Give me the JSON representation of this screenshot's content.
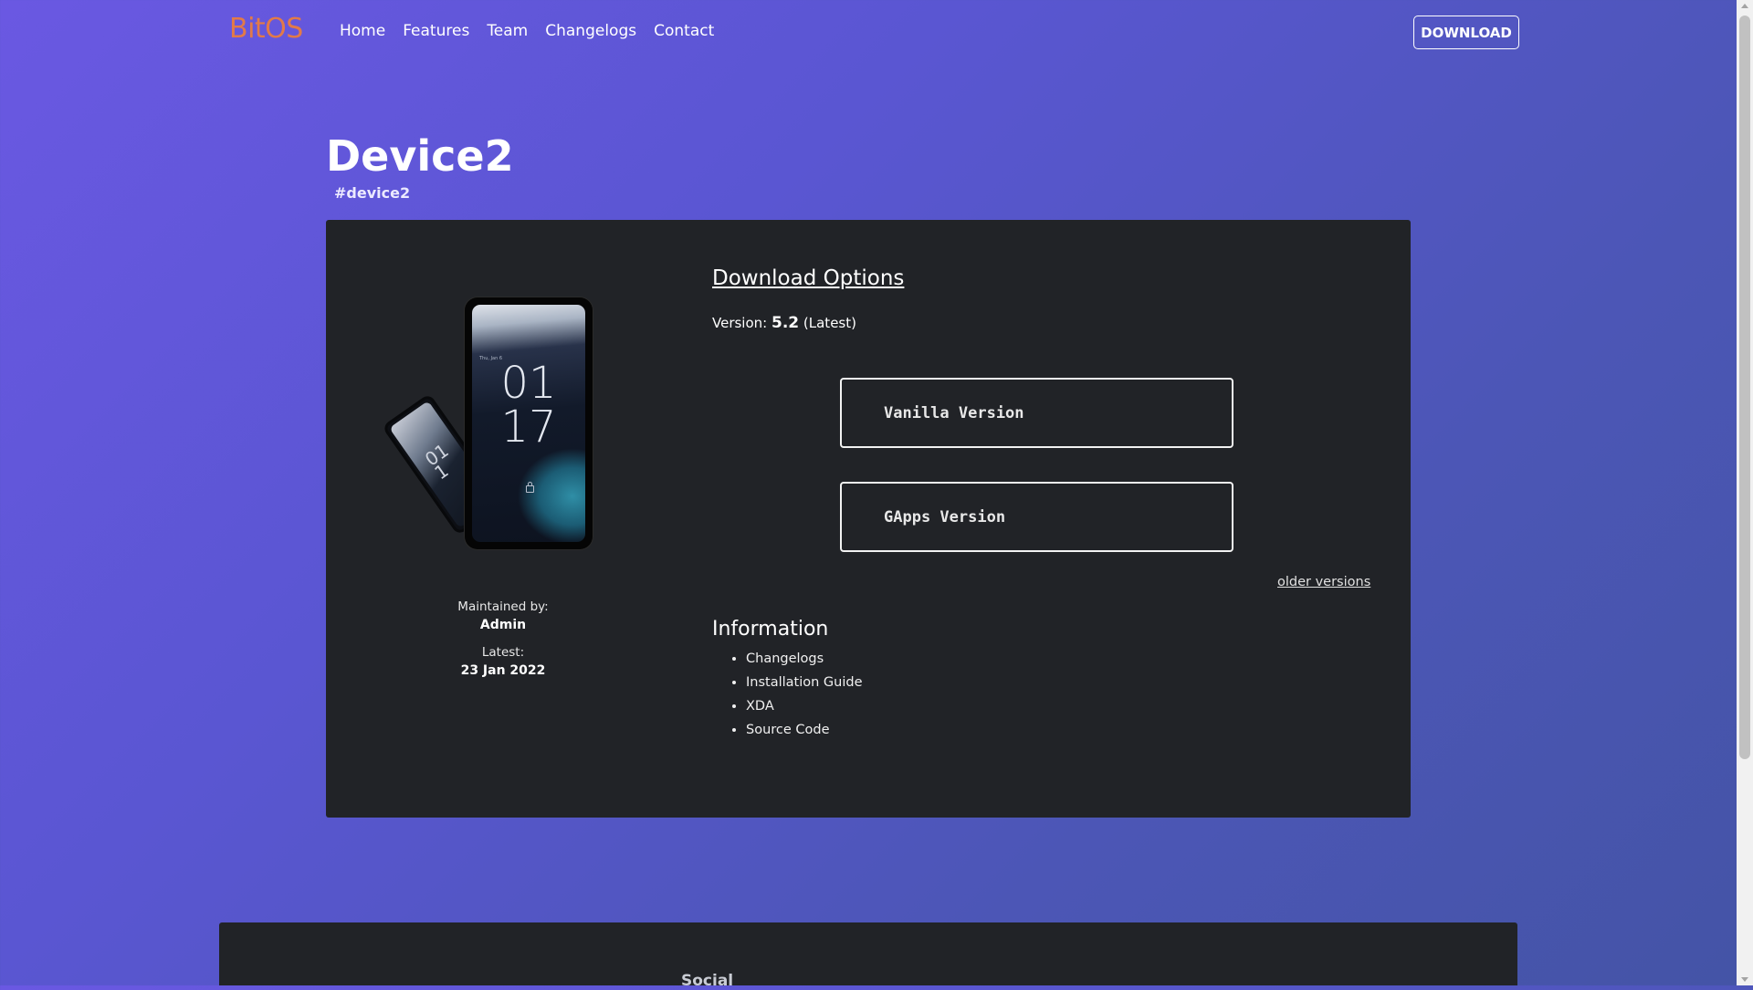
{
  "nav": {
    "brand": "BitOS",
    "links": [
      "Home",
      "Features",
      "Team",
      "Changelogs",
      "Contact"
    ],
    "download_label": "DOWNLOAD"
  },
  "device": {
    "title": "Device2",
    "tag": "#device2",
    "phone_clock_hours": "01",
    "phone_clock_minutes": "17",
    "back_phone_clock": "01 1",
    "maintained_by_label": "Maintained by:",
    "maintainer": "Admin",
    "latest_label": "Latest:",
    "latest_date": "23 Jan 2022"
  },
  "download": {
    "title": "Download Options",
    "version_prefix": "Version:",
    "version_number": "5.2",
    "version_suffix": "(Latest)",
    "vanilla_label": "Vanilla Version",
    "gapps_label": "GApps Version",
    "older_label": "older versions"
  },
  "information": {
    "title": "Information",
    "items": [
      "Changelogs",
      "Installation Guide",
      "XDA",
      "Source Code"
    ]
  },
  "footer": {
    "social_label": "Social"
  },
  "colors": {
    "brand": "#e27a48",
    "card_background": "#212327",
    "page_gradient_start": "#6a58e2",
    "page_gradient_end": "#4454a6"
  }
}
